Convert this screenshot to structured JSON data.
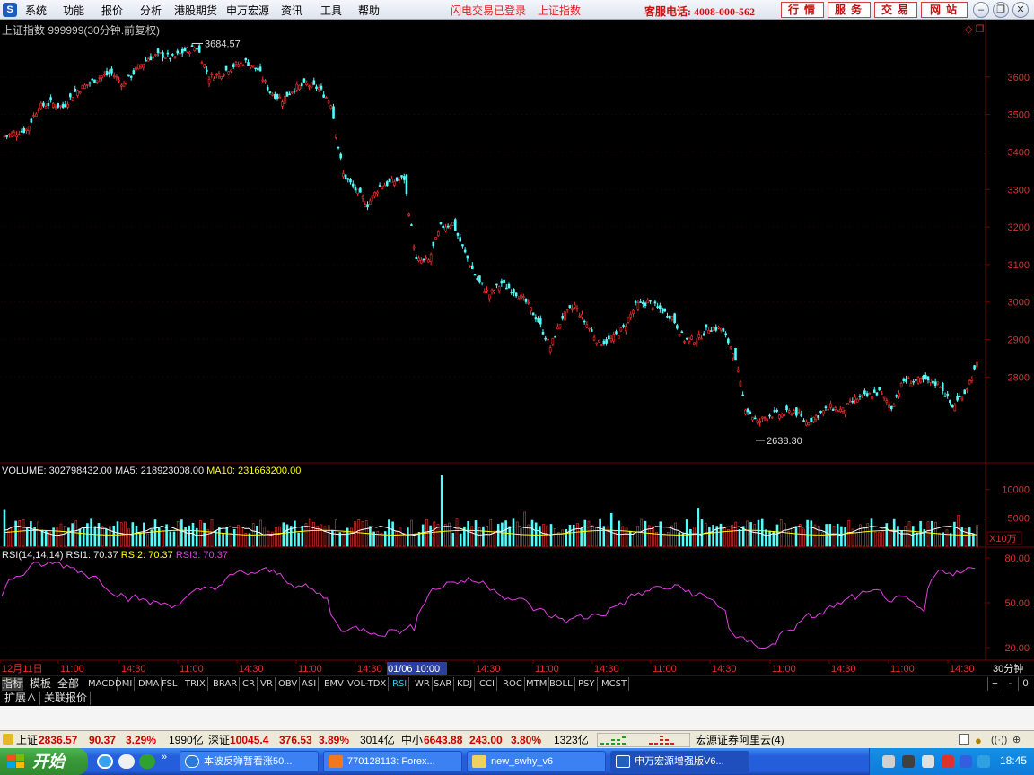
{
  "menu": {
    "items": [
      "系统",
      "功能",
      "报价",
      "分析",
      "港股期货",
      "申万宏源",
      "资讯",
      "工具",
      "帮助"
    ],
    "status": "闪电交易已登录",
    "index_link": "上证指数",
    "hotline": "客服电话: 4008-000-562",
    "buttons": [
      "行情",
      "服务",
      "交易",
      "网站"
    ]
  },
  "chart": {
    "title": "上证指数 999999(30分钟.前复权)",
    "high_label": "3684.57",
    "low_label": "2638.30",
    "price_ticks": [
      "3600",
      "3500",
      "3400",
      "3300",
      "3200",
      "3100",
      "3000",
      "2900",
      "2800"
    ],
    "volume_header": {
      "label": "VOLUME: 302798432.00",
      "ma5": "MA5: 218923008.00",
      "ma10": "MA10: 231663200.00"
    },
    "volume_ticks": [
      "10000",
      "5000"
    ],
    "volume_unit": "X10万",
    "rsi_header": {
      "label": "RSI(14,14,14)",
      "rsi1": "RSI1: 70.37",
      "rsi2": "RSI2: 70.37",
      "rsi3": "RSI3: 70.37"
    },
    "rsi_ticks": [
      "80.00",
      "50.00",
      "20.00"
    ],
    "time_labels": [
      "12月11日",
      "11:00",
      "14:30",
      "11:00",
      "14:30",
      "11:00",
      "14:30",
      "01/06 10:00",
      "14:30",
      "11:00",
      "14:30",
      "11:00",
      "14:30",
      "11:00",
      "14:30",
      "11:00",
      "14:30"
    ],
    "period": "30分钟",
    "colors": {
      "up": "#ff3232",
      "down": "#54fcfc",
      "rsi": "#e040e0",
      "ma5": "#ffffff",
      "ma10": "#ffff00",
      "grid": "#7a0000"
    }
  },
  "chart_data": {
    "type": "candlestick",
    "title": "上证指数 999999(30分钟.前复权)",
    "price_range": [
      2600,
      3700
    ],
    "annotations": [
      {
        "text": "3684.57",
        "value": 3684.57
      },
      {
        "text": "2638.30",
        "value": 2638.3
      }
    ],
    "close_trend": [
      3450,
      3460,
      3520,
      3530,
      3520,
      3560,
      3580,
      3600,
      3610,
      3580,
      3620,
      3650,
      3660,
      3650,
      3670,
      3680,
      3600,
      3610,
      3630,
      3640,
      3620,
      3560,
      3540,
      3570,
      3580,
      3570,
      3530,
      3340,
      3300,
      3260,
      3310,
      3320,
      3330,
      3110,
      3110,
      3200,
      3210,
      3130,
      3060,
      3020,
      3050,
      3030,
      3000,
      2950,
      2880,
      2960,
      2990,
      2940,
      2890,
      2900,
      2930,
      2990,
      3000,
      2980,
      2960,
      2900,
      2900,
      2930,
      2930,
      2870,
      2720,
      2680,
      2700,
      2700,
      2710,
      2680,
      2700,
      2720,
      2710,
      2740,
      2750,
      2760,
      2720,
      2790,
      2790,
      2790,
      2780,
      2720,
      2760,
      2830
    ]
  },
  "tabs": {
    "mode": [
      "指标",
      "模板",
      "全部"
    ],
    "indicators": [
      "MACD",
      "DMI",
      "DMA",
      "FSL",
      "TRIX",
      "BRAR",
      "CR",
      "VR",
      "OBV",
      "ASI",
      "EMV",
      "VOL-TDX",
      "RSI",
      "WR",
      "SAR",
      "KDJ",
      "CCI",
      "ROC",
      "MTM",
      "BOLL",
      "PSY",
      "MCST"
    ],
    "controls": [
      "+",
      "-",
      "0"
    ],
    "sub": [
      "扩展∧",
      "关联报价"
    ]
  },
  "status": {
    "sh_label": "上证",
    "sh_val": "2836.57",
    "sh_chg": "90.37",
    "sh_pct": "3.29%",
    "sh_amt": "1990亿",
    "sz_label": "深证",
    "sz_val": "10045.4",
    "sz_chg": "376.53",
    "sz_pct": "3.89%",
    "sz_amt": "3014亿",
    "zx_label": "中小",
    "zx_val": "6643.88",
    "zx_chg": "243.00",
    "zx_pct": "3.80%",
    "zx_amt": "1323亿",
    "broker": "宏源证券阿里云(4)"
  },
  "taskbar": {
    "start": "开始",
    "tasks": [
      "本波反弹暂看涨50...",
      "770128113: Forex...",
      "new_swhy_v6",
      "申万宏源增强版V6..."
    ],
    "clock": "18:45"
  }
}
